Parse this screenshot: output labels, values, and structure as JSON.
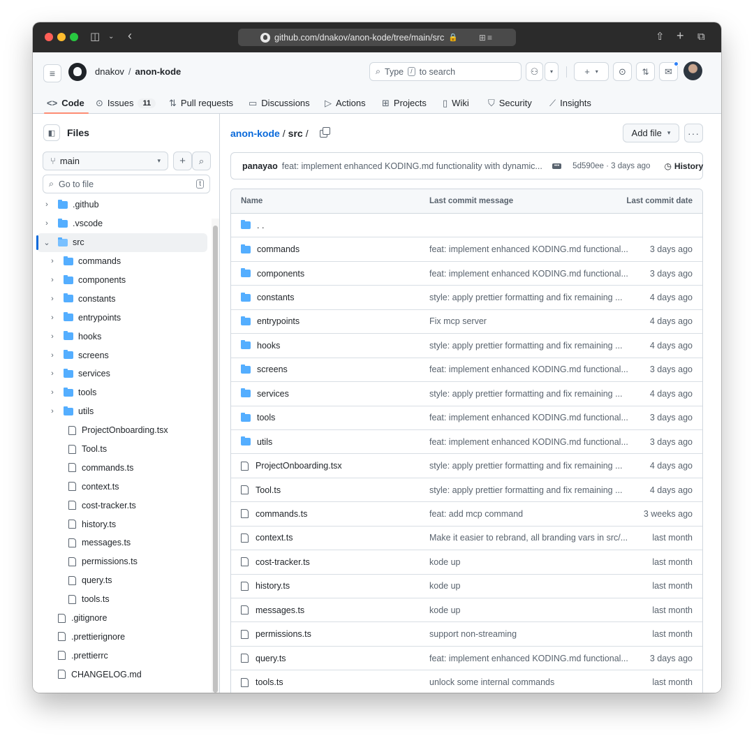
{
  "browser": {
    "url": "github.com/dnakov/anon-kode/tree/main/src"
  },
  "header": {
    "owner": "dnakov",
    "separator": "/",
    "repo": "anon-kode",
    "search_prefix": "Type",
    "search_key": "/",
    "search_suffix": "to search"
  },
  "tabs": [
    {
      "label": "Code",
      "icon": "code-icon"
    },
    {
      "label": "Issues",
      "count": "11",
      "icon": "issue-icon"
    },
    {
      "label": "Pull requests",
      "icon": "pull-request-icon"
    },
    {
      "label": "Discussions",
      "icon": "discussion-icon"
    },
    {
      "label": "Actions",
      "icon": "play-icon"
    },
    {
      "label": "Projects",
      "icon": "table-icon"
    },
    {
      "label": "Wiki",
      "icon": "book-icon"
    },
    {
      "label": "Security",
      "icon": "shield-icon"
    },
    {
      "label": "Insights",
      "icon": "graph-icon"
    }
  ],
  "sidebar": {
    "title": "Files",
    "branch": "main",
    "goto_placeholder": "Go to file",
    "goto_key": "t",
    "tree": [
      {
        "name": ".github",
        "type": "folder",
        "level": 0,
        "expanded": false
      },
      {
        "name": ".vscode",
        "type": "folder",
        "level": 0,
        "expanded": false
      },
      {
        "name": "src",
        "type": "folder",
        "level": 0,
        "expanded": true,
        "selected": true
      },
      {
        "name": "commands",
        "type": "folder",
        "level": 1,
        "expanded": false
      },
      {
        "name": "components",
        "type": "folder",
        "level": 1,
        "expanded": false
      },
      {
        "name": "constants",
        "type": "folder",
        "level": 1,
        "expanded": false
      },
      {
        "name": "entrypoints",
        "type": "folder",
        "level": 1,
        "expanded": false
      },
      {
        "name": "hooks",
        "type": "folder",
        "level": 1,
        "expanded": false
      },
      {
        "name": "screens",
        "type": "folder",
        "level": 1,
        "expanded": false
      },
      {
        "name": "services",
        "type": "folder",
        "level": 1,
        "expanded": false
      },
      {
        "name": "tools",
        "type": "folder",
        "level": 1,
        "expanded": false
      },
      {
        "name": "utils",
        "type": "folder",
        "level": 1,
        "expanded": false
      },
      {
        "name": "ProjectOnboarding.tsx",
        "type": "file",
        "level": 1
      },
      {
        "name": "Tool.ts",
        "type": "file",
        "level": 1
      },
      {
        "name": "commands.ts",
        "type": "file",
        "level": 1
      },
      {
        "name": "context.ts",
        "type": "file",
        "level": 1
      },
      {
        "name": "cost-tracker.ts",
        "type": "file",
        "level": 1
      },
      {
        "name": "history.ts",
        "type": "file",
        "level": 1
      },
      {
        "name": "messages.ts",
        "type": "file",
        "level": 1
      },
      {
        "name": "permissions.ts",
        "type": "file",
        "level": 1
      },
      {
        "name": "query.ts",
        "type": "file",
        "level": 1
      },
      {
        "name": "tools.ts",
        "type": "file",
        "level": 1
      },
      {
        "name": ".gitignore",
        "type": "file",
        "level": 0
      },
      {
        "name": ".prettierignore",
        "type": "file",
        "level": 0
      },
      {
        "name": ".prettierrc",
        "type": "file",
        "level": 0
      },
      {
        "name": "CHANGELOG.md",
        "type": "file",
        "level": 0
      }
    ]
  },
  "main": {
    "path_repo": "anon-kode",
    "path_sep": "/",
    "path_dir": "src",
    "path_trailing": "/",
    "add_file": "Add file",
    "more": "···",
    "commit": {
      "author": "panayao",
      "message": "feat: implement enhanced KODING.md functionality with dynamic...",
      "meta": "5d590ee · 3 days ago",
      "history": "History"
    },
    "table_headers": {
      "name": "Name",
      "message": "Last commit message",
      "date": "Last commit date"
    },
    "parent_dir": ". .",
    "rows": [
      {
        "name": "commands",
        "type": "folder",
        "message": "feat: implement enhanced KODING.md functional...",
        "date": "3 days ago"
      },
      {
        "name": "components",
        "type": "folder",
        "message": "feat: implement enhanced KODING.md functional...",
        "date": "3 days ago"
      },
      {
        "name": "constants",
        "type": "folder",
        "message": "style: apply prettier formatting and fix remaining ...",
        "date": "4 days ago"
      },
      {
        "name": "entrypoints",
        "type": "folder",
        "message": "Fix mcp server",
        "date": "4 days ago"
      },
      {
        "name": "hooks",
        "type": "folder",
        "message": "style: apply prettier formatting and fix remaining ...",
        "date": "4 days ago"
      },
      {
        "name": "screens",
        "type": "folder",
        "message": "feat: implement enhanced KODING.md functional...",
        "date": "3 days ago"
      },
      {
        "name": "services",
        "type": "folder",
        "message": "style: apply prettier formatting and fix remaining ...",
        "date": "4 days ago"
      },
      {
        "name": "tools",
        "type": "folder",
        "message": "feat: implement enhanced KODING.md functional...",
        "date": "3 days ago"
      },
      {
        "name": "utils",
        "type": "folder",
        "message": "feat: implement enhanced KODING.md functional...",
        "date": "3 days ago"
      },
      {
        "name": "ProjectOnboarding.tsx",
        "type": "file",
        "message": "style: apply prettier formatting and fix remaining ...",
        "date": "4 days ago"
      },
      {
        "name": "Tool.ts",
        "type": "file",
        "message": "style: apply prettier formatting and fix remaining ...",
        "date": "4 days ago"
      },
      {
        "name": "commands.ts",
        "type": "file",
        "message": "feat: add mcp command",
        "date": "3 weeks ago"
      },
      {
        "name": "context.ts",
        "type": "file",
        "message": "Make it easier to rebrand, all branding vars in src/...",
        "date": "last month"
      },
      {
        "name": "cost-tracker.ts",
        "type": "file",
        "message": "kode up",
        "date": "last month"
      },
      {
        "name": "history.ts",
        "type": "file",
        "message": "kode up",
        "date": "last month"
      },
      {
        "name": "messages.ts",
        "type": "file",
        "message": "kode up",
        "date": "last month"
      },
      {
        "name": "permissions.ts",
        "type": "file",
        "message": "support non-streaming",
        "date": "last month"
      },
      {
        "name": "query.ts",
        "type": "file",
        "message": "feat: implement enhanced KODING.md functional...",
        "date": "3 days ago"
      },
      {
        "name": "tools.ts",
        "type": "file",
        "message": "unlock some internal commands",
        "date": "last month"
      }
    ]
  },
  "colors": {
    "accent": "#0969da",
    "folder": "#54aeff",
    "tab_underline": "#fd8c73",
    "notification": "#2f81f7"
  }
}
